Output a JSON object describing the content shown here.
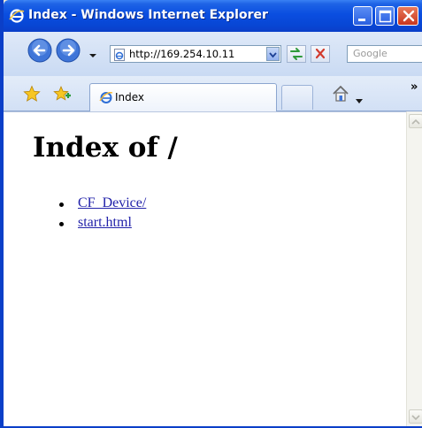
{
  "window": {
    "title": "Index - Windows Internet Explorer",
    "title_icon": "ie-logo-icon",
    "buttons": [
      "minimize-icon",
      "maximize-icon",
      "close-icon"
    ]
  },
  "navigation": {
    "address": "http://169.254.10.11",
    "search_placeholder": "Google",
    "icons": [
      "back-arrow-icon",
      "forward-arrow-icon",
      "chevron-down-icon",
      "page-icon",
      "refresh-icon",
      "stop-icon"
    ]
  },
  "tabs": {
    "active_tab_label": "Index",
    "more_label": "»",
    "icons": [
      "favorites-star-icon",
      "add-favorites-icon",
      "ie-page-icon",
      "home-icon"
    ]
  },
  "page": {
    "heading": "Index of /",
    "links": [
      {
        "label": "CF_Device/"
      },
      {
        "label": "start.html"
      }
    ]
  },
  "colors": {
    "titlebar": "#0a4ee0",
    "link": "#2222aa",
    "close_button": "#c8361e"
  }
}
